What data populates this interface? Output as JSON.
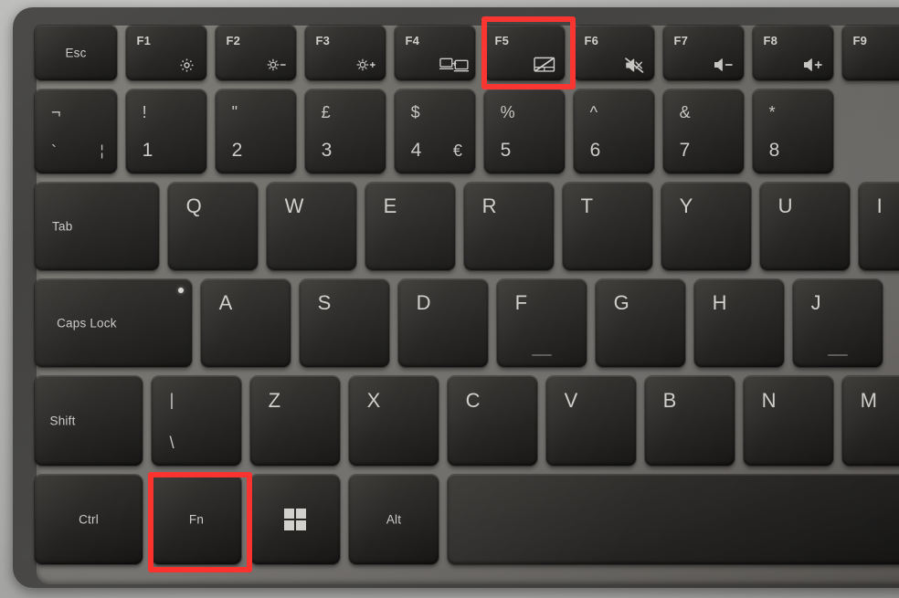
{
  "scene": {
    "title": "Laptop keyboard close-up",
    "description": "UK-layout laptop keyboard photo with Fn and F5 keys highlighted in red",
    "colors": {
      "highlight": "#f9322e",
      "key_face": "#2a2927",
      "deck": "#6f6d68",
      "chassis": "#444341",
      "background": "#b6b6b4",
      "legend_text": "#cbcac7"
    }
  },
  "highlights": [
    {
      "id": "f5-highlight",
      "target": "F5",
      "label": "F5 key highlighted"
    },
    {
      "id": "fn-highlight",
      "target": "Fn",
      "label": "Fn key highlighted"
    }
  ],
  "rows": {
    "function_row": [
      {
        "id": "esc",
        "label": "Esc",
        "type": "word",
        "align": "center",
        "icon": null
      },
      {
        "id": "f1",
        "label": "F1",
        "type": "fn",
        "align": "tl",
        "icon": "gear-icon",
        "icon_title": "Settings"
      },
      {
        "id": "f2",
        "label": "F2",
        "type": "fn",
        "align": "tl",
        "icon": "brightness-down-icon",
        "icon_title": "Brightness down"
      },
      {
        "id": "f3",
        "label": "F3",
        "type": "fn",
        "align": "tl",
        "icon": "brightness-up-icon",
        "icon_title": "Brightness up"
      },
      {
        "id": "f4",
        "label": "F4",
        "type": "fn",
        "align": "tl",
        "icon": "display-switch-icon",
        "icon_title": "Switch display"
      },
      {
        "id": "f5",
        "label": "F5",
        "type": "fn",
        "align": "tl",
        "icon": "touchpad-off-icon",
        "icon_title": "Touchpad on/off",
        "highlighted": true
      },
      {
        "id": "f6",
        "label": "F6",
        "type": "fn",
        "align": "tl",
        "icon": "mute-icon",
        "icon_title": "Mute"
      },
      {
        "id": "f7",
        "label": "F7",
        "type": "fn",
        "align": "tl",
        "icon": "volume-down-icon",
        "icon_title": "Volume down"
      },
      {
        "id": "f8",
        "label": "F8",
        "type": "fn",
        "align": "tl",
        "icon": "volume-up-icon",
        "icon_title": "Volume up"
      },
      {
        "id": "f9",
        "label": "F9",
        "type": "fn",
        "align": "tl",
        "icon": null,
        "clipped": true
      }
    ],
    "number_row": [
      {
        "id": "backtick",
        "upper": "¬",
        "lower": "`",
        "third": "¦"
      },
      {
        "id": "k1",
        "upper": "!",
        "lower": "1",
        "third": ""
      },
      {
        "id": "k2",
        "upper": "\"",
        "lower": "2",
        "third": ""
      },
      {
        "id": "k3",
        "upper": "£",
        "lower": "3",
        "third": ""
      },
      {
        "id": "k4",
        "upper": "$",
        "lower": "4",
        "third": "€"
      },
      {
        "id": "k5",
        "upper": "%",
        "lower": "5",
        "third": ""
      },
      {
        "id": "k6",
        "upper": "^",
        "lower": "6",
        "third": ""
      },
      {
        "id": "k7",
        "upper": "&",
        "lower": "7",
        "third": ""
      },
      {
        "id": "k8",
        "upper": "*",
        "lower": "8",
        "third": ""
      }
    ],
    "top_row": [
      {
        "id": "tab",
        "label": "Tab",
        "type": "word",
        "align": "left"
      },
      {
        "id": "q",
        "label": "Q",
        "type": "alpha"
      },
      {
        "id": "w",
        "label": "W",
        "type": "alpha"
      },
      {
        "id": "e",
        "label": "E",
        "type": "alpha"
      },
      {
        "id": "r",
        "label": "R",
        "type": "alpha"
      },
      {
        "id": "t",
        "label": "T",
        "type": "alpha"
      },
      {
        "id": "y",
        "label": "Y",
        "type": "alpha"
      },
      {
        "id": "u",
        "label": "U",
        "type": "alpha"
      },
      {
        "id": "i",
        "label": "I",
        "type": "alpha",
        "clipped": true
      }
    ],
    "home_row": [
      {
        "id": "capslock",
        "label": "Caps Lock",
        "type": "word",
        "align": "left",
        "led": true
      },
      {
        "id": "a",
        "label": "A",
        "type": "alpha"
      },
      {
        "id": "s",
        "label": "S",
        "type": "alpha"
      },
      {
        "id": "d",
        "label": "D",
        "type": "alpha"
      },
      {
        "id": "f",
        "label": "F",
        "type": "alpha",
        "homing": true
      },
      {
        "id": "g",
        "label": "G",
        "type": "alpha"
      },
      {
        "id": "h",
        "label": "H",
        "type": "alpha"
      },
      {
        "id": "j",
        "label": "J",
        "type": "alpha",
        "homing": true
      }
    ],
    "bottom_row": [
      {
        "id": "shift",
        "label": "Shift",
        "type": "word",
        "align": "left"
      },
      {
        "id": "pipe",
        "upper": "|",
        "lower": "\\",
        "third": ""
      },
      {
        "id": "z",
        "label": "Z",
        "type": "alpha"
      },
      {
        "id": "x",
        "label": "X",
        "type": "alpha"
      },
      {
        "id": "c",
        "label": "C",
        "type": "alpha"
      },
      {
        "id": "v",
        "label": "V",
        "type": "alpha"
      },
      {
        "id": "b",
        "label": "B",
        "type": "alpha"
      },
      {
        "id": "n",
        "label": "N",
        "type": "alpha"
      },
      {
        "id": "m",
        "label": "M",
        "type": "alpha",
        "clipped": true
      }
    ],
    "modifier_row": [
      {
        "id": "ctrl",
        "label": "Ctrl",
        "type": "word",
        "align": "center"
      },
      {
        "id": "fn",
        "label": "Fn",
        "type": "word",
        "align": "center",
        "highlighted": true
      },
      {
        "id": "win",
        "label": "",
        "type": "icon",
        "icon": "windows-icon",
        "icon_title": "Windows"
      },
      {
        "id": "alt",
        "label": "Alt",
        "type": "word",
        "align": "center"
      },
      {
        "id": "space",
        "label": "",
        "type": "space"
      }
    ]
  }
}
